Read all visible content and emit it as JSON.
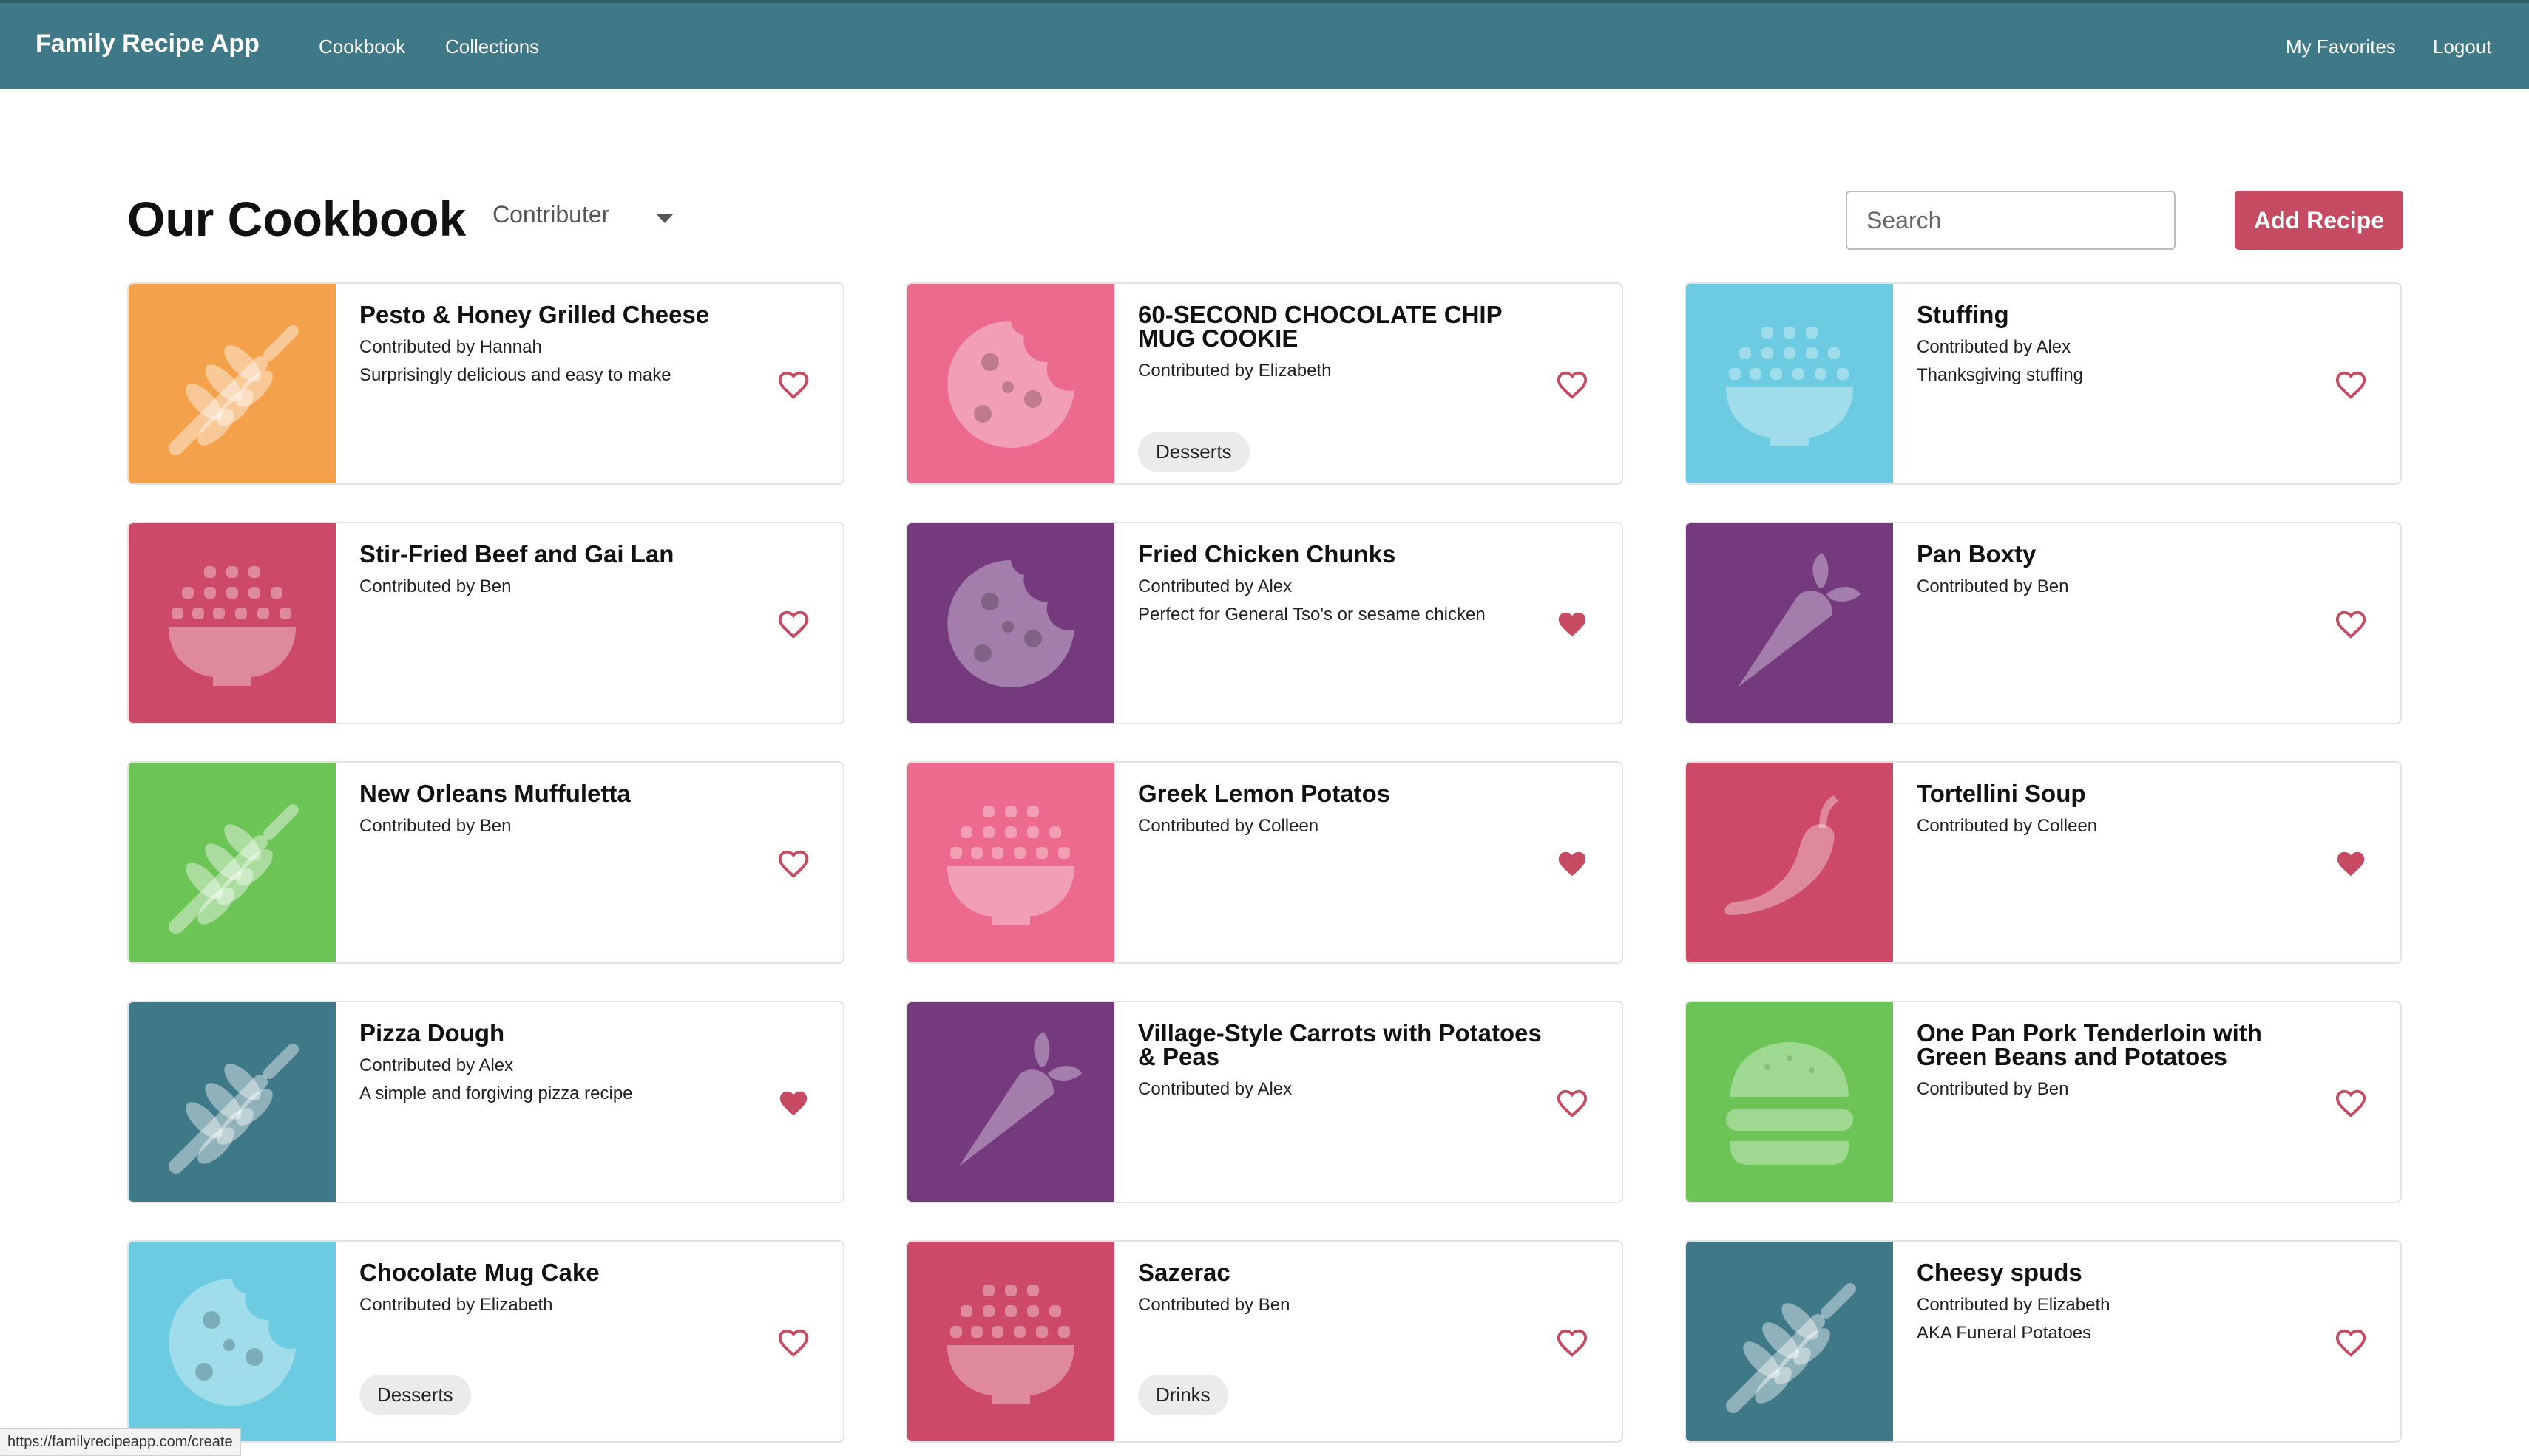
{
  "nav": {
    "brand": "Family Recipe App",
    "links": [
      "Cookbook",
      "Collections"
    ],
    "right_links": [
      "My Favorites",
      "Logout"
    ]
  },
  "header": {
    "title": "Our Cookbook",
    "filter_label": "Contributer",
    "search_placeholder": "Search",
    "add_button": "Add Recipe"
  },
  "colors": {
    "navbar": "#3f7987",
    "accent": "#c64b62",
    "orange": "#f3a24b",
    "pink": "#ec6a8e",
    "sky": "#6ccbe0",
    "rose": "#cc4a67",
    "purple": "#743a7d",
    "green": "#6cc356",
    "teal": "#3f7987"
  },
  "recipes": [
    {
      "title": "Pesto & Honey Grilled Cheese",
      "contributor": "Contributed by Hannah",
      "description": "Surprisingly delicious and easy to make",
      "tag": "",
      "favorite": false,
      "icon": "wheat-icon",
      "color": "#f3a24b"
    },
    {
      "title": "60-SECOND CHOCOLATE CHIP MUG COOKIE",
      "contributor": "Contributed by Elizabeth",
      "description": "",
      "tag": "Desserts",
      "favorite": false,
      "icon": "cookie-icon",
      "color": "#ec6a8e"
    },
    {
      "title": "Stuffing",
      "contributor": "Contributed by Alex",
      "description": "Thanksgiving stuffing",
      "tag": "",
      "favorite": false,
      "icon": "bowl-icon",
      "color": "#6ccbe0"
    },
    {
      "title": "Stir-Fried Beef and Gai Lan",
      "contributor": "Contributed by Ben",
      "description": "",
      "tag": "",
      "favorite": false,
      "icon": "bowl-icon",
      "color": "#cc4a67"
    },
    {
      "title": "Fried Chicken Chunks",
      "contributor": "Contributed by Alex",
      "description": "Perfect for General Tso's or sesame chicken",
      "tag": "",
      "favorite": true,
      "icon": "cookie-icon",
      "color": "#743a7d"
    },
    {
      "title": "Pan Boxty",
      "contributor": "Contributed by Ben",
      "description": "",
      "tag": "",
      "favorite": false,
      "icon": "carrot-icon",
      "color": "#743a7d"
    },
    {
      "title": "New Orleans Muffuletta",
      "contributor": "Contributed by Ben",
      "description": "",
      "tag": "",
      "favorite": false,
      "icon": "wheat-icon",
      "color": "#6cc356"
    },
    {
      "title": "Greek Lemon Potatos",
      "contributor": "Contributed by Colleen",
      "description": "",
      "tag": "",
      "favorite": true,
      "icon": "bowl-icon",
      "color": "#ec6a8e"
    },
    {
      "title": "Tortellini Soup",
      "contributor": "Contributed by Colleen",
      "description": "",
      "tag": "",
      "favorite": true,
      "icon": "pepper-icon",
      "color": "#cc4a67"
    },
    {
      "title": "Pizza Dough",
      "contributor": "Contributed by Alex",
      "description": "A simple and forgiving pizza recipe",
      "tag": "",
      "favorite": true,
      "icon": "wheat-icon",
      "color": "#3f7987"
    },
    {
      "title": "Village-Style Carrots with Potatoes & Peas",
      "contributor": "Contributed by Alex",
      "description": "",
      "tag": "",
      "favorite": false,
      "icon": "carrot-icon",
      "color": "#743a7d"
    },
    {
      "title": "One Pan Pork Tenderloin with Green Beans and Potatoes",
      "contributor": "Contributed by Ben",
      "description": "",
      "tag": "",
      "favorite": false,
      "icon": "burger-icon",
      "color": "#6cc356"
    },
    {
      "title": "Chocolate Mug Cake",
      "contributor": "Contributed by Elizabeth",
      "description": "",
      "tag": "Desserts",
      "favorite": false,
      "icon": "cookie-icon",
      "color": "#6ccbe0"
    },
    {
      "title": "Sazerac",
      "contributor": "Contributed by Ben",
      "description": "",
      "tag": "Drinks",
      "favorite": false,
      "icon": "bowl-icon",
      "color": "#cc4a67"
    },
    {
      "title": "Cheesy spuds",
      "contributor": "Contributed by Elizabeth",
      "description": "AKA Funeral Potatoes",
      "tag": "",
      "favorite": false,
      "icon": "wheat-icon",
      "color": "#3f7987"
    }
  ],
  "status_bar": {
    "url": "https://familyrecipeapp.com/create"
  }
}
